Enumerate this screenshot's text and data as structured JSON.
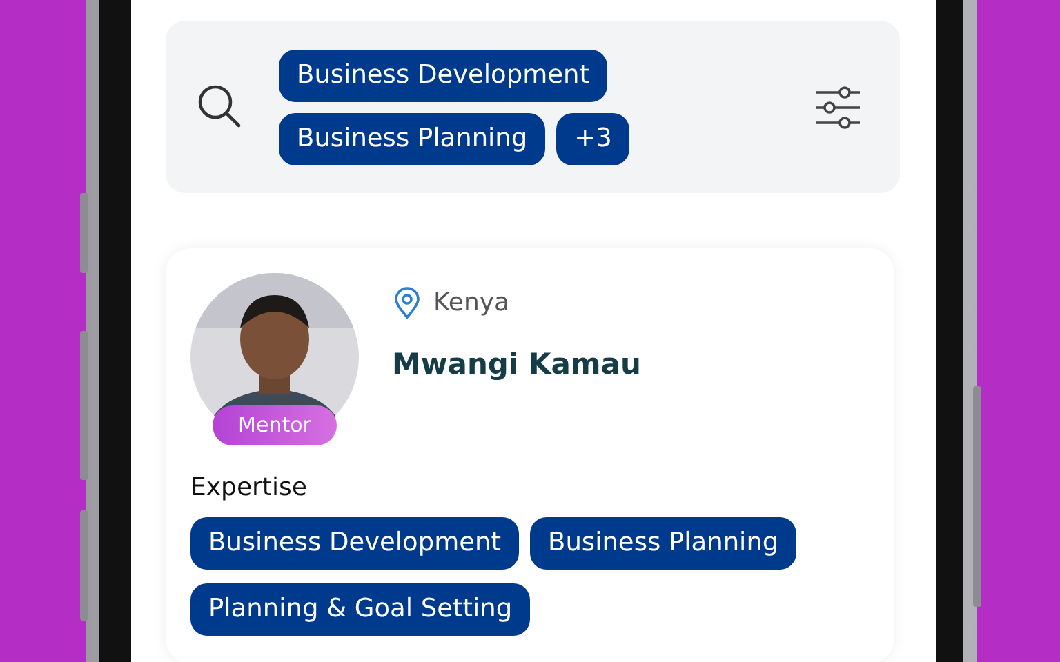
{
  "search": {
    "chips": [
      {
        "label": "Business Development"
      },
      {
        "label": "Business Planning"
      },
      {
        "label": "+3"
      }
    ]
  },
  "profile": {
    "badge": "Mentor",
    "location": "Kenya",
    "name": "Mwangi Kamau",
    "expertise_label": "Expertise",
    "expertise": [
      {
        "label": "Business Development"
      },
      {
        "label": "Business Planning"
      },
      {
        "label": "Planning & Goal Setting"
      }
    ]
  }
}
